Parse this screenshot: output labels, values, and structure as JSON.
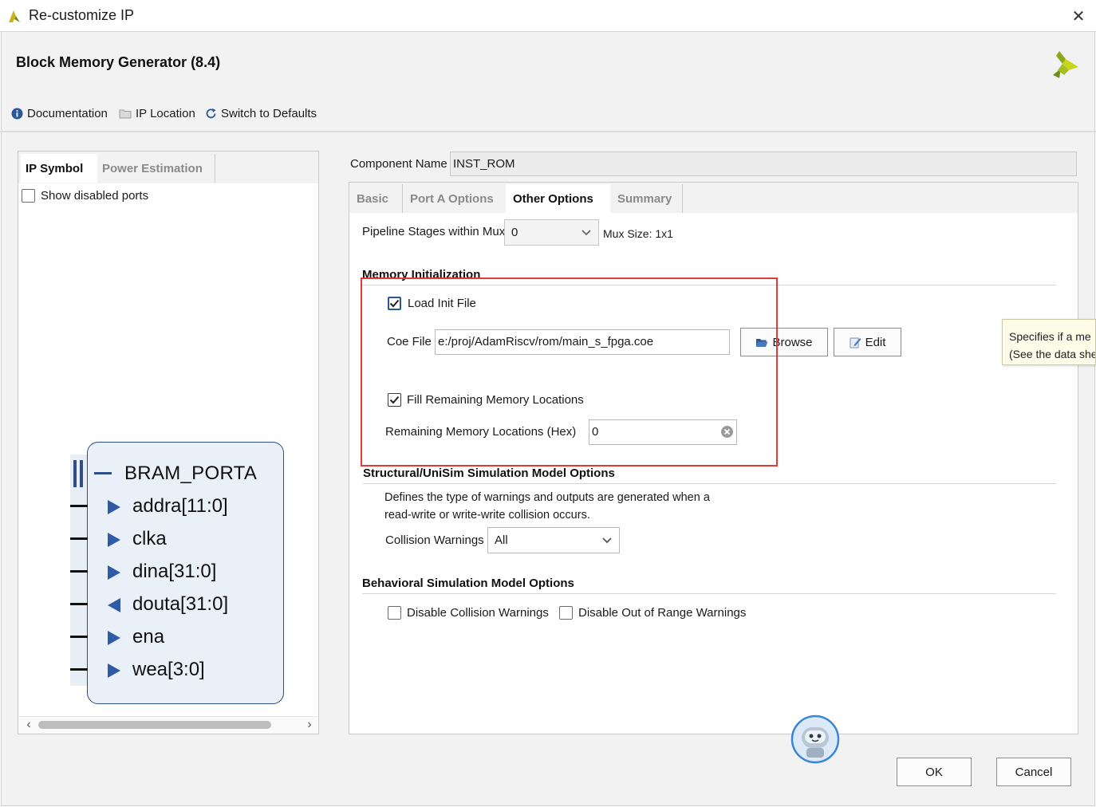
{
  "window": {
    "title": "Re-customize IP",
    "close_glyph": "✕"
  },
  "ip": {
    "title": "Block Memory Generator (8.4)"
  },
  "toolbar": {
    "documentation": "Documentation",
    "ip_location": "IP Location",
    "switch_defaults": "Switch to Defaults"
  },
  "left": {
    "tabs": {
      "ip_symbol": "IP Symbol",
      "power": "Power Estimation"
    },
    "show_disabled": "Show disabled ports",
    "symbol": {
      "interface": "BRAM_PORTA",
      "ports": [
        {
          "name": "addra[11:0]",
          "dir": "in"
        },
        {
          "name": "clka",
          "dir": "in"
        },
        {
          "name": "dina[31:0]",
          "dir": "in"
        },
        {
          "name": "douta[31:0]",
          "dir": "out"
        },
        {
          "name": "ena",
          "dir": "in"
        },
        {
          "name": "wea[3:0]",
          "dir": "in"
        }
      ]
    },
    "scroll_left": "‹",
    "scroll_right": "›"
  },
  "right": {
    "component_label": "Component Name",
    "component_value": "INST_ROM",
    "tabs": {
      "basic": "Basic",
      "porta": "Port A Options",
      "other": "Other Options",
      "summary": "Summary"
    },
    "pipeline_label": "Pipeline Stages within Mux",
    "pipeline_value": "0",
    "mux_size": "Mux Size: 1x1",
    "memory_init": {
      "title": "Memory Initialization",
      "load_init_label": "Load Init File",
      "load_init_checked": true,
      "coe_label": "Coe File",
      "coe_value": "e:/proj/AdamRiscv/rom/main_s_fpga.coe",
      "browse": "Browse",
      "edit": "Edit",
      "fill_label": "Fill Remaining Memory Locations",
      "fill_checked": true,
      "remaining_label": "Remaining Memory Locations (Hex)",
      "remaining_value": "0"
    },
    "structural": {
      "title": "Structural/UniSim Simulation Model Options",
      "desc_line1": "Defines the type of warnings and outputs are generated when a",
      "desc_line2": "read-write or write-write collision occurs.",
      "collision_label": "Collision Warnings",
      "collision_value": "All"
    },
    "behavioral": {
      "title": "Behavioral Simulation Model Options",
      "disable_collision": "Disable Collision Warnings",
      "disable_range": "Disable Out of Range Warnings"
    },
    "tooltip": {
      "line1": "Specifies if a me",
      "line2": "(See the data she"
    }
  },
  "footer": {
    "ok": "OK",
    "cancel": "Cancel"
  },
  "colors": {
    "highlight_box": "#e03a3a",
    "symbol_border": "#2f4e86",
    "symbol_fill": "#eaf0f7",
    "arrow": "#2f5aa8"
  }
}
